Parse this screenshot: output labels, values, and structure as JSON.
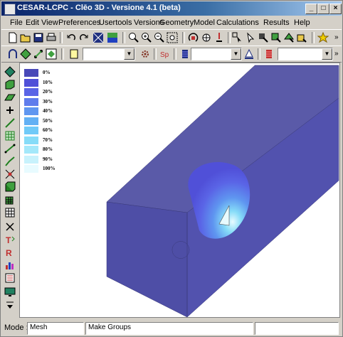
{
  "window": {
    "title": "CESAR-LCPC - Clēo 3D - Versione 4.1 (beta)",
    "buttons": {
      "minimize": "_",
      "maximize": "□",
      "close": "×"
    }
  },
  "menu": [
    "File",
    "Edit",
    "View",
    "Preferences",
    "Usertools",
    "Versions",
    "Geometry",
    "Model",
    "Calculations",
    "Results",
    "Help"
  ],
  "toolbar": {
    "more": "»",
    "combo1_value": "",
    "combo2_value": "",
    "combo3_value": "",
    "combo_arrow": "▼"
  },
  "legend": {
    "entries": [
      {
        "label": "0%",
        "color": "#4848b8"
      },
      {
        "label": "10%",
        "color": "#5050d8"
      },
      {
        "label": "20%",
        "color": "#5a64e6"
      },
      {
        "label": "30%",
        "color": "#5f7cec"
      },
      {
        "label": "40%",
        "color": "#5f96f0"
      },
      {
        "label": "50%",
        "color": "#62b0f4"
      },
      {
        "label": "60%",
        "color": "#70caf8"
      },
      {
        "label": "70%",
        "color": "#86dcf8"
      },
      {
        "label": "80%",
        "color": "#a4e8fa"
      },
      {
        "label": "90%",
        "color": "#c8f2fc"
      },
      {
        "label": "100%",
        "color": "#e8fbff"
      }
    ]
  },
  "status": {
    "mode_label": "Mode :",
    "mode_value": "Mesh",
    "action_value": "Make Groups",
    "extra_value": ""
  },
  "colors": {
    "model_top": "#5a5aa8",
    "model_front": "#4e4ea6",
    "model_side": "#5252ae"
  }
}
